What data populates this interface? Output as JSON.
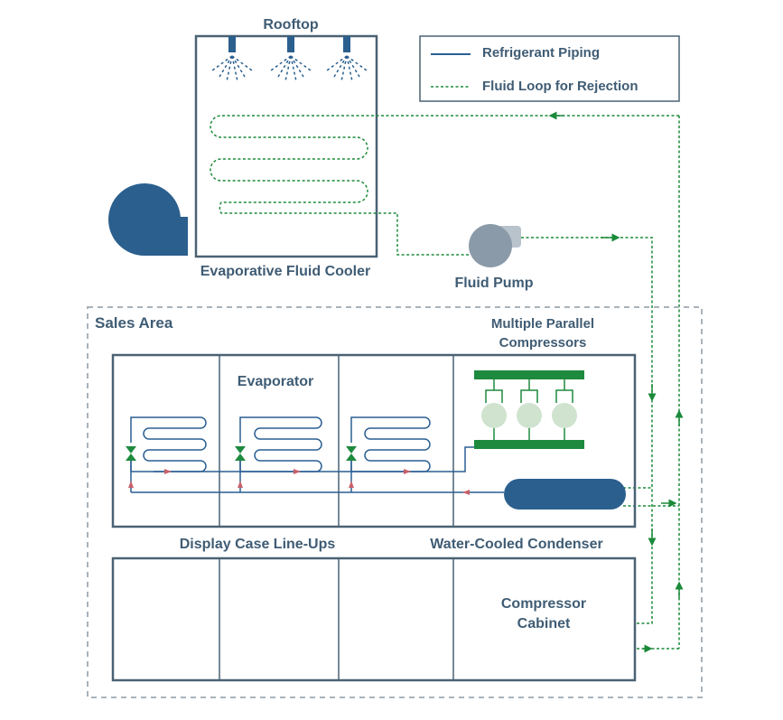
{
  "labels": {
    "rooftop": "Rooftop",
    "evaporative_fluid_cooler": "Evaporative Fluid Cooler",
    "fluid_pump": "Fluid Pump",
    "sales_area": "Sales Area",
    "multiple_parallel_compressors_line1": "Multiple Parallel",
    "multiple_parallel_compressors_line2": "Compressors",
    "evaporator": "Evaporator",
    "display_case_lineups": "Display Case Line-Ups",
    "water_cooled_condenser": "Water-Cooled Condenser",
    "compressor_cabinet_line1": "Compressor",
    "compressor_cabinet_line2": "Cabinet"
  },
  "legend": {
    "items": [
      {
        "label": "Refrigerant Piping",
        "style": "solid",
        "color": "#2a5f93"
      },
      {
        "label": "Fluid Loop for Rejection",
        "style": "dashed",
        "color": "#1b8a3a"
      }
    ]
  },
  "colors": {
    "refrigerant": "#2a5f93",
    "fluid_loop": "#1b8a3a",
    "equipment_blue": "#2b5f8e",
    "frame": "#4a6274",
    "sales_area_border": "#a9b3bb",
    "text": "#3f5c74",
    "flow_arrow_red": "#c8606a",
    "pump_gray": "#8a9aa8",
    "compressor_green": "#1e8a3e",
    "compressor_light": "#cfe3cf"
  }
}
